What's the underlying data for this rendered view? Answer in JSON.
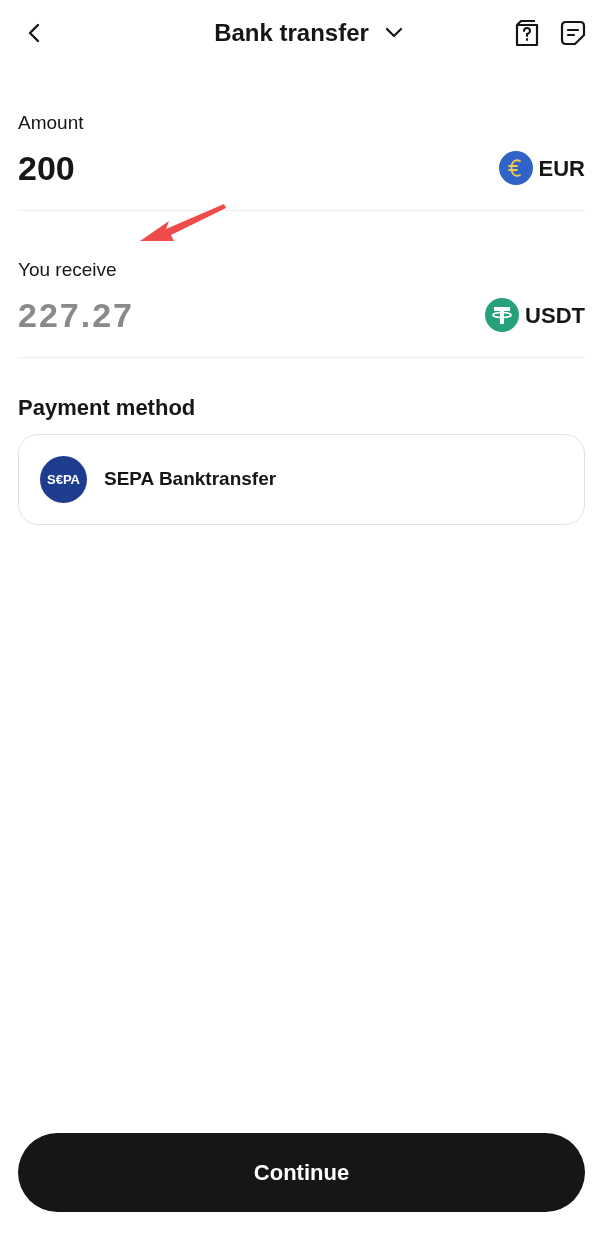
{
  "header": {
    "title": "Bank transfer"
  },
  "amount": {
    "label": "Amount",
    "value": "200",
    "currency": "EUR"
  },
  "receive": {
    "label": "You receive",
    "value": "227.27",
    "currency": "USDT"
  },
  "payment_method": {
    "heading": "Payment method",
    "logo": "S€PA",
    "name": "SEPA Banktransfer"
  },
  "continue_button": "Continue"
}
